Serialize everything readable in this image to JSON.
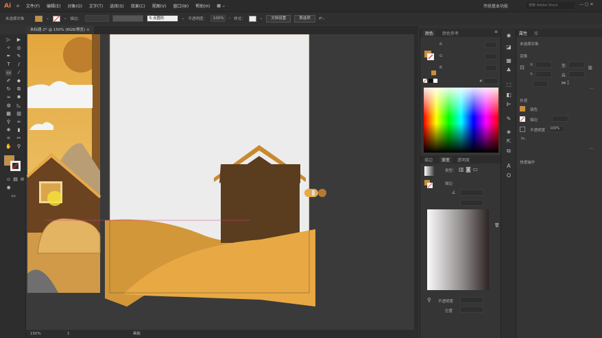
{
  "app": {
    "logo": "Ai",
    "workspace": "传统基本功能",
    "search_placeholder": "搜索 Adobe Stock"
  },
  "menu": [
    "文件(F)",
    "编辑(E)",
    "对象(O)",
    "文字(T)",
    "选择(S)",
    "效果(C)",
    "视图(V)",
    "窗口(W)",
    "帮助(H)"
  ],
  "control": {
    "selection": "未选择对象",
    "stroke_label": "描边：",
    "brush": "5 点圆形",
    "opacity_label": "不透明度：",
    "opacity": "100%",
    "style_label": "样式：",
    "doc_setup": "文档设置",
    "prefs": "首选项",
    "fill_color": "#c98f3a"
  },
  "document_tab": {
    "title": "未标题-2* @ 150% (RGB/预览)",
    "close": "×"
  },
  "status": {
    "zoom": "150%",
    "artboard": "1",
    "tool": "画板"
  },
  "color_panel": {
    "tabs": [
      "颜色",
      "颜色参考"
    ],
    "channels": [
      "R",
      "G",
      "B"
    ],
    "hex_label": "#"
  },
  "gradient_panel": {
    "tabs": [
      "描边",
      "渐变",
      "透明度"
    ],
    "type_label": "类型：",
    "stroke_label": "描边",
    "opacity_label": "不透明度",
    "location_label": "位置"
  },
  "properties": {
    "tabs": [
      "属性",
      "库"
    ],
    "selection": "未选择对象",
    "transform": "变换",
    "x": "X:",
    "y": "Y:",
    "w": "宽:",
    "h": "高:",
    "appearance": "外观",
    "fill": "填色",
    "stroke": "描边",
    "opacity_label": "不透明度",
    "opacity": "100%",
    "fx": "fx.",
    "quick_actions": "快速操作"
  },
  "colors": {
    "accent_fill": "#c98f3a",
    "house": "#5a3c1f",
    "roof": "#c8892f",
    "hill_back": "#d29739",
    "hill_front": "#e8a944",
    "artboard": "#ececec"
  }
}
